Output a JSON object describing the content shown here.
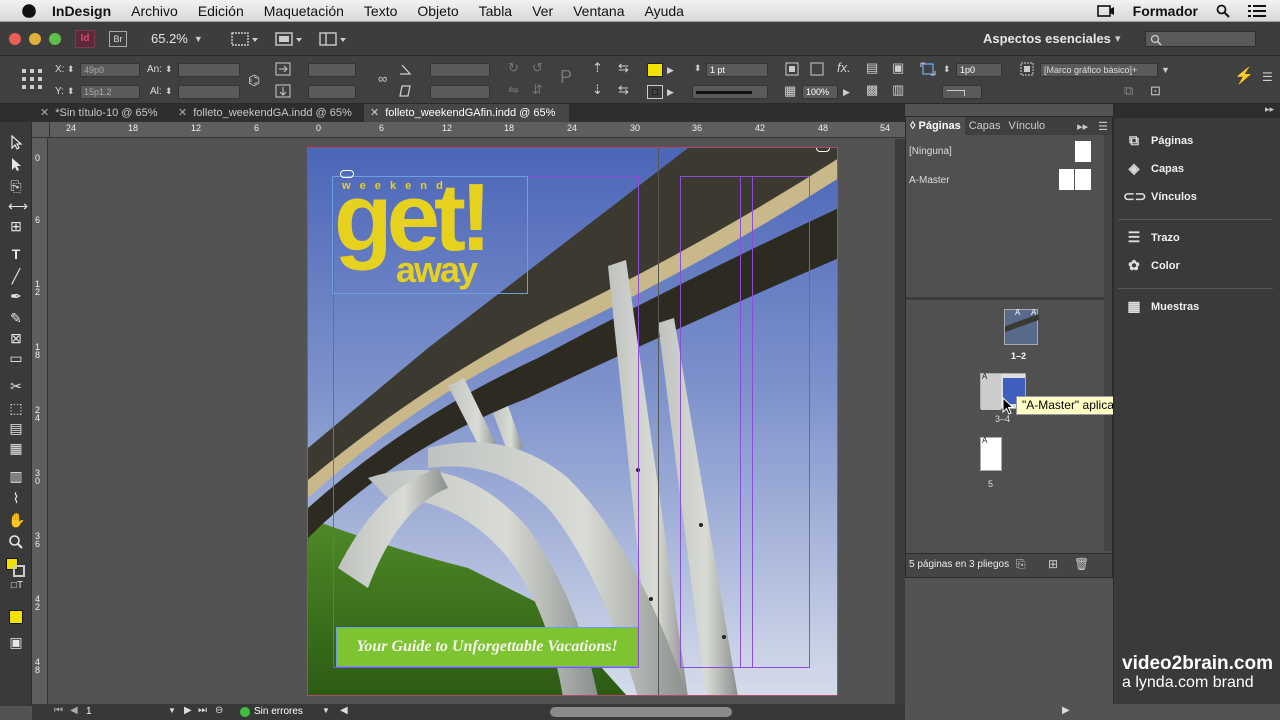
{
  "menubar": {
    "app": "InDesign",
    "items": [
      "Archivo",
      "Edición",
      "Maquetación",
      "Texto",
      "Objeto",
      "Tabla",
      "Ver",
      "Ventana",
      "Ayuda"
    ],
    "right_label": "Formador"
  },
  "appbar": {
    "br_label": "Br",
    "zoom": "65.2%",
    "workspace": "Aspectos esenciales",
    "workspace_arrow": "▾"
  },
  "control": {
    "x_label": "X:",
    "x_value": "49p0",
    "y_label": "Y:",
    "y_value": "15p1.2",
    "w_label": "An:",
    "h_label": "Al:",
    "stroke_weight": "1 pt",
    "opacity": "100%",
    "frame_offset": "1p0",
    "object_style": "[Marco gráfico básico]+"
  },
  "tabs": [
    {
      "label": "*Sin título-10 @ 65%",
      "active": false
    },
    {
      "label": "folleto_weekendGA.indd @ 65%",
      "active": false
    },
    {
      "label": "folleto_weekendGAfin.indd @ 65%",
      "active": true
    }
  ],
  "ruler_h": [
    "24",
    "18",
    "12",
    "6",
    "0",
    "6",
    "12",
    "18",
    "24",
    "30",
    "36",
    "42",
    "48",
    "54"
  ],
  "ruler_v": [
    "0",
    "6",
    "1 2",
    "1 8",
    "2 4",
    "3 0",
    "3 6",
    "4 2",
    "4 8"
  ],
  "document": {
    "eyebrow": "w e e k e n d",
    "headline_1": "get!",
    "headline_2": "away",
    "banner": "Your Guide to Unforgettable Vacations!"
  },
  "status": {
    "page": "1",
    "preflight": "Sin errores"
  },
  "pages_panel": {
    "tabs": [
      "Páginas",
      "Capas",
      "Vínculo"
    ],
    "masters": [
      "[Ninguna]",
      "A-Master"
    ],
    "spread_labels": [
      "1–2",
      "3–4",
      "5"
    ],
    "master_prefix": "A",
    "footer": "5 páginas en 3 pliegos"
  },
  "tooltip": "\"A-Master\" aplicada",
  "dock": {
    "items": [
      "Páginas",
      "Capas",
      "Vínculos",
      "Trazo",
      "Color",
      "Muestras"
    ]
  },
  "watermark": {
    "line1": "video2brain.com",
    "line2": "a lynda.com brand"
  },
  "colors": {
    "accent_yellow": "#e6d11f",
    "banner_green": "#7ec332",
    "margin_purple": "#8a4fd6"
  }
}
